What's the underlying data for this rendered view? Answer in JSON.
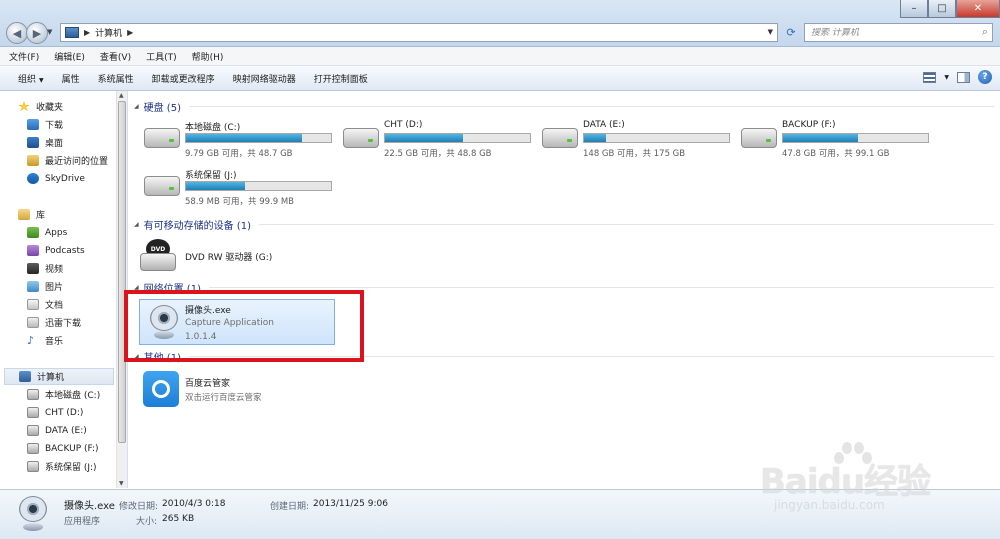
{
  "window": {
    "address": {
      "crumb": "计算机"
    },
    "search": {
      "placeholder": "搜索 计算机"
    }
  },
  "menu": [
    "文件(F)",
    "编辑(E)",
    "查看(V)",
    "工具(T)",
    "帮助(H)"
  ],
  "commands": [
    "组织",
    "属性",
    "系统属性",
    "卸载或更改程序",
    "映射网络驱动器",
    "打开控制面板"
  ],
  "nav": {
    "favorites_header": "收藏夹",
    "favorites": [
      "下载",
      "桌面",
      "最近访问的位置",
      "SkyDrive"
    ],
    "libraries_header": "库",
    "libraries": [
      "Apps",
      "Podcasts",
      "视频",
      "图片",
      "文档",
      "迅雷下载",
      "音乐"
    ],
    "computer_header": "计算机",
    "computer": [
      "本地磁盘 (C:)",
      "CHT (D:)",
      "DATA (E:)",
      "BACKUP (F:)",
      "系统保留 (J:)"
    ]
  },
  "groups": {
    "hdd": "硬盘 (5)",
    "removable": "有可移动存储的设备 (1)",
    "network": "网络位置 (1)",
    "other": "其他 (1)"
  },
  "drives": [
    {
      "name": "本地磁盘 (C:)",
      "size": "9.79 GB 可用，共 48.7 GB",
      "used": 0.8
    },
    {
      "name": "CHT (D:)",
      "size": "22.5 GB 可用，共 48.8 GB",
      "used": 0.54
    },
    {
      "name": "DATA (E:)",
      "size": "148 GB 可用，共 175 GB",
      "used": 0.15
    },
    {
      "name": "BACKUP (F:)",
      "size": "47.8 GB 可用，共 99.1 GB",
      "used": 0.52
    },
    {
      "name": "系统保留 (J:)",
      "size": "58.9 MB 可用，共 99.9 MB",
      "used": 0.41
    }
  ],
  "dvd": {
    "name": "DVD RW 驱动器 (G:)",
    "disc_label": "DVD"
  },
  "network_item": {
    "name": "摄像头.exe",
    "desc": "Capture Application",
    "version": "1.0.1.4"
  },
  "other_item": {
    "name": "百度云管家",
    "desc": "双击运行百度云管家"
  },
  "details": {
    "name": "摄像头.exe",
    "type": "应用程序",
    "modified_label": "修改日期:",
    "modified": "2010/4/3 0:18",
    "created_label": "创建日期:",
    "created": "2013/11/25 9:06",
    "size_label": "大小:",
    "size": "265 KB"
  },
  "watermark": {
    "brand": "Baidu经验",
    "site": "jingyan.baidu.com"
  },
  "colors": {
    "highlight": "#d9141c",
    "bar_fill": "#1d7fb8",
    "group_header": "#1e3287"
  }
}
